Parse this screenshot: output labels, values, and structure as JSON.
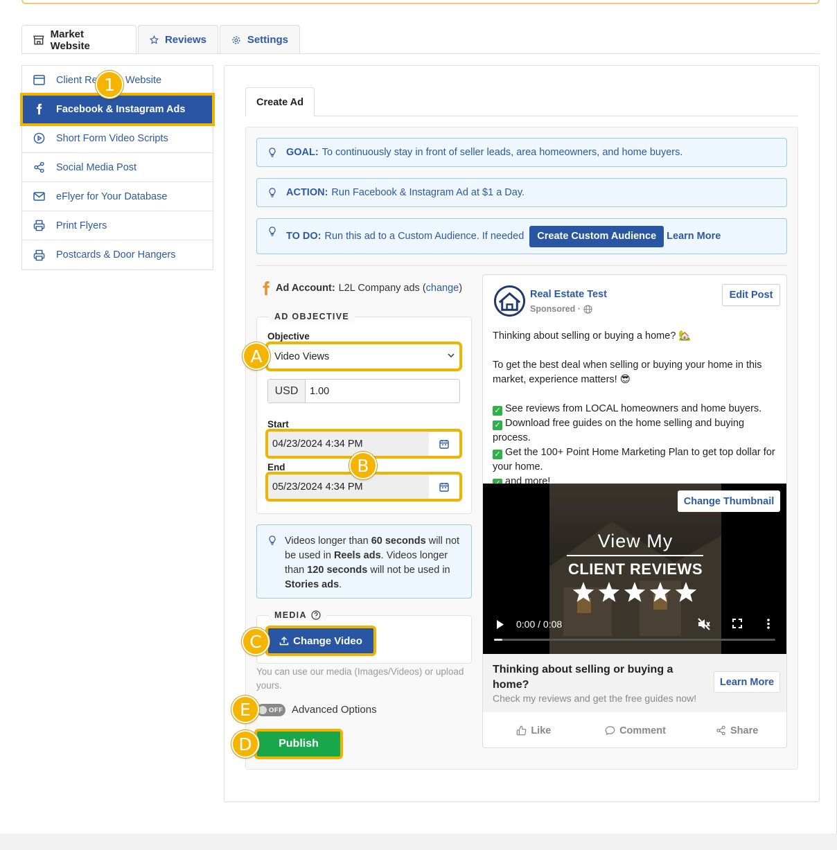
{
  "tabs": [
    {
      "label": "Market Website",
      "icon": "store-icon"
    },
    {
      "label": "Reviews",
      "icon": "star-icon"
    },
    {
      "label": "Settings",
      "icon": "gear-icon"
    }
  ],
  "sidebar": {
    "items": [
      {
        "label": "Client Reviews Website",
        "icon": "browser-window-icon"
      },
      {
        "label": "Facebook & Instagram Ads",
        "icon": "facebook-icon"
      },
      {
        "label": "Short Form Video Scripts",
        "icon": "play-circle-icon"
      },
      {
        "label": "Social Media Post",
        "icon": "share-icon"
      },
      {
        "label": "eFlyer for Your Database",
        "icon": "envelope-icon"
      },
      {
        "label": "Print Flyers",
        "icon": "printer-icon"
      },
      {
        "label": "Postcards & Door Hangers",
        "icon": "printer-icon"
      }
    ]
  },
  "subtab": {
    "label": "Create Ad"
  },
  "info": {
    "goal_label": "GOAL:",
    "goal_text": "To continuously stay in front of seller leads, area homeowners, and home buyers.",
    "action_label": "ACTION:",
    "action_text": "Run Facebook & Instagram Ad at $1 a Day.",
    "todo_label": "TO DO:",
    "todo_text": "Run this ad to a Custom Audience. If needed",
    "create_audience_button": "Create Custom Audience",
    "learn_more_link": "Learn More"
  },
  "ad_account": {
    "label": "Ad Account:",
    "value": "L2L Company ads",
    "change_link": "change"
  },
  "ad_objective": {
    "legend": "AD OBJECTIVE",
    "objective_label": "Objective",
    "objective_value": "Video Views",
    "currency": "USD",
    "budget": "1.00",
    "start_label": "Start",
    "start_value": "04/23/2024 4:34 PM",
    "end_label": "End",
    "end_value": "05/23/2024 4:34 PM"
  },
  "video_note": {
    "t1": "Videos longer than ",
    "b1": "60 seconds",
    "t2": " will not be used in ",
    "b2": "Reels ads",
    "t3": ". Videos longer than ",
    "b3": "120 seconds",
    "t4": " will not be used in ",
    "b4": "Stories ads",
    "t5": "."
  },
  "media": {
    "legend": "MEDIA",
    "change_video_button": "Change Video",
    "hint": "You can use our media (Images/Videos) or upload yours."
  },
  "advanced": {
    "toggle_text": "OFF",
    "label": "Advanced Options"
  },
  "publish_button": "Publish",
  "post": {
    "page_name": "Real Estate Test",
    "sponsored": "Sponsored ·",
    "edit_button": "Edit Post",
    "line1": "Thinking about selling or buying a home? 🏡",
    "line2": "To get the best deal when selling or buying your home in this market, experience matters! 😎",
    "bullet1": "See reviews from LOCAL homeowners and home buyers.",
    "bullet2": "Download free guides on the home selling and buying process.",
    "bullet3": "Get the 100+ Point Home Marketing Plan to get top dollar for your home.",
    "bullet4": "and more!",
    "video": {
      "title1": "View My",
      "title2": "CLIENT REVIEWS",
      "stars": 5,
      "time": "0:00 / 0:08",
      "progress": 0.03,
      "change_thumbnail_button": "Change Thumbnail"
    },
    "footer_headline": "Thinking about selling or buying a home?",
    "footer_sub": "Check my reviews and get the free guides now!",
    "learn_more_button": "Learn More",
    "actions": {
      "like": "Like",
      "comment": "Comment",
      "share": "Share"
    }
  },
  "markers": [
    "1",
    "A",
    "B",
    "C",
    "D",
    "E"
  ],
  "colors": {
    "primary": "#2856a3",
    "highlight": "#f0b400",
    "publish": "#18a84a",
    "info_bg": "#eef7fd",
    "info_border": "#9ccbe6"
  }
}
